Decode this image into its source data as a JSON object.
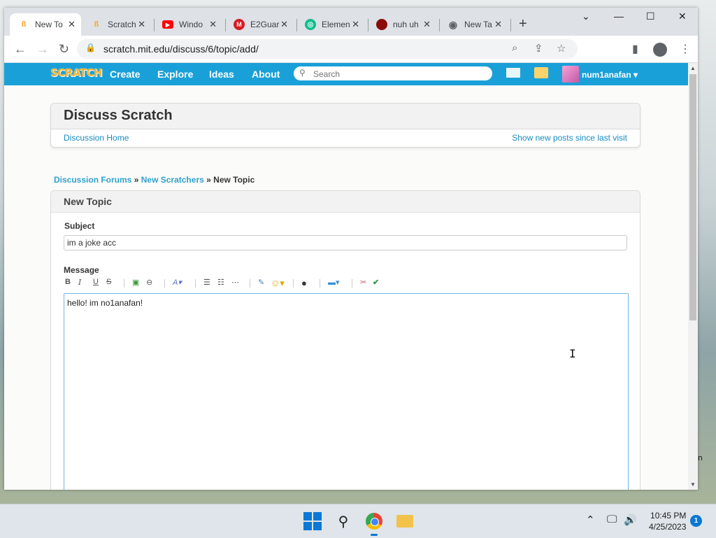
{
  "browser": {
    "tabs": [
      {
        "title": "New To",
        "favicon": "scratch-cat-icon",
        "active": true
      },
      {
        "title": "Scratch",
        "favicon": "scratch-cat-icon",
        "active": false
      },
      {
        "title": "Windo",
        "favicon": "youtube-icon",
        "active": false
      },
      {
        "title": "E2Guar",
        "favicon": "m-logo-icon",
        "active": false
      },
      {
        "title": "Elemen",
        "favicon": "element-icon",
        "active": false
      },
      {
        "title": "nuh uh",
        "favicon": "red-circle-icon",
        "active": false
      },
      {
        "title": "New Ta",
        "favicon": "chrome-icon",
        "active": false
      }
    ],
    "url": "scratch.mit.edu/discuss/6/topic/add/"
  },
  "scratch_nav": {
    "logo": "SCRATCH",
    "links": [
      "Create",
      "Explore",
      "Ideas",
      "About"
    ],
    "search_placeholder": "Search",
    "username": "num1anafan",
    "username_caret": "▾"
  },
  "discuss": {
    "title": "Discuss Scratch",
    "home_link": "Discussion Home",
    "new_posts_link": "Show new posts since last visit"
  },
  "breadcrumb": {
    "forums": "Discussion Forums",
    "sep": "»",
    "category": "New Scratchers",
    "current": "New Topic"
  },
  "form": {
    "heading": "New Topic",
    "subject_label": "Subject",
    "subject_value": "im a joke acc",
    "message_label": "Message",
    "message_value": "hello! im no1anafan!",
    "toolbar": [
      "B",
      "I",
      "U",
      "S"
    ]
  },
  "taskbar": {
    "time": "10:45 PM",
    "date": "4/25/2023",
    "notification_count": "1"
  },
  "desktop": {
    "edge_text": "n"
  },
  "colors": {
    "scratch_blue": "#1aa0d8",
    "link_blue": "#1a8cc0",
    "tab_strip": "#dee1e6",
    "windows_accent": "#0a78d4"
  }
}
